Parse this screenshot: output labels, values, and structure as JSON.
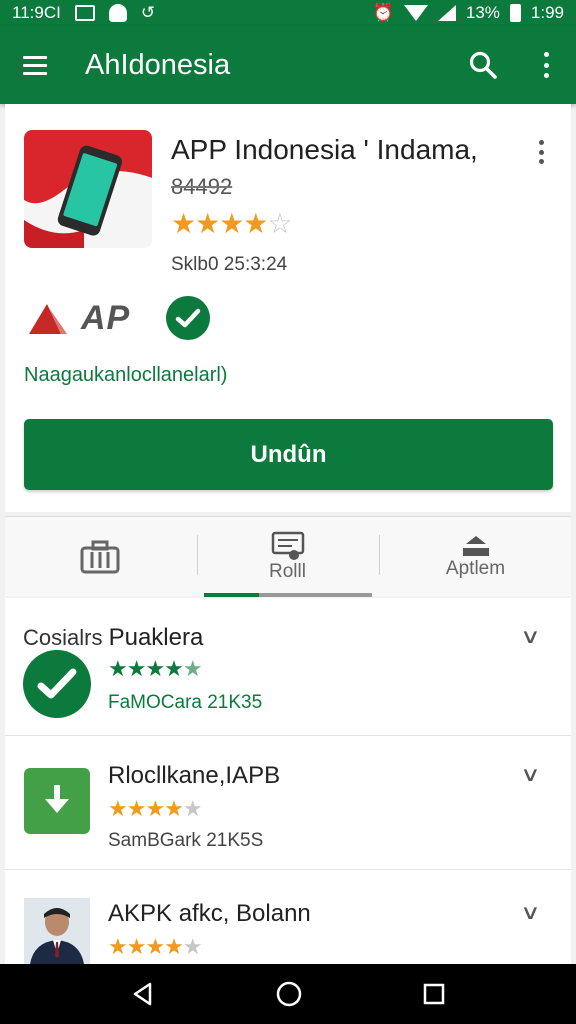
{
  "status_bar": {
    "time_left": "11:9CI",
    "battery_text": "13%",
    "time_right": "1:99"
  },
  "app_bar": {
    "title": "AhIdonesia"
  },
  "app": {
    "title": "APP Indonesia ' Indama,",
    "subtitle": "84492",
    "rating": 4,
    "meta": "Sklb0 25:3:24",
    "publisher_logo_text": "AP",
    "link_text": "Naagaukanlocllanelarl)",
    "install_label": "Undûn"
  },
  "tabs": [
    {
      "label": "",
      "icon": "briefcase-icon"
    },
    {
      "label": "Rolll",
      "icon": "review-icon"
    },
    {
      "label": "Aptlem",
      "icon": "upload-icon"
    }
  ],
  "list": {
    "header_prefix": "Cosialrs",
    "items": [
      {
        "title": "Puaklera",
        "rating": 4.5,
        "meta": "FaMOCara 21K35",
        "icon": "check-circle-icon",
        "meta_color": "#0c7a3c"
      },
      {
        "title": "Rlocllkane,IAPB",
        "rating": 4,
        "meta": "SamBGark 21K5S",
        "icon": "download-icon",
        "meta_color": "#444444"
      },
      {
        "title": "AKPK afkc, Bolann",
        "rating": 4,
        "meta": "",
        "icon": "person-avatar-icon",
        "meta_color": "#444444"
      }
    ]
  },
  "colors": {
    "primary": "#0c7a3c",
    "star": "#f29a1f",
    "star_off": "#c7c7c7"
  }
}
